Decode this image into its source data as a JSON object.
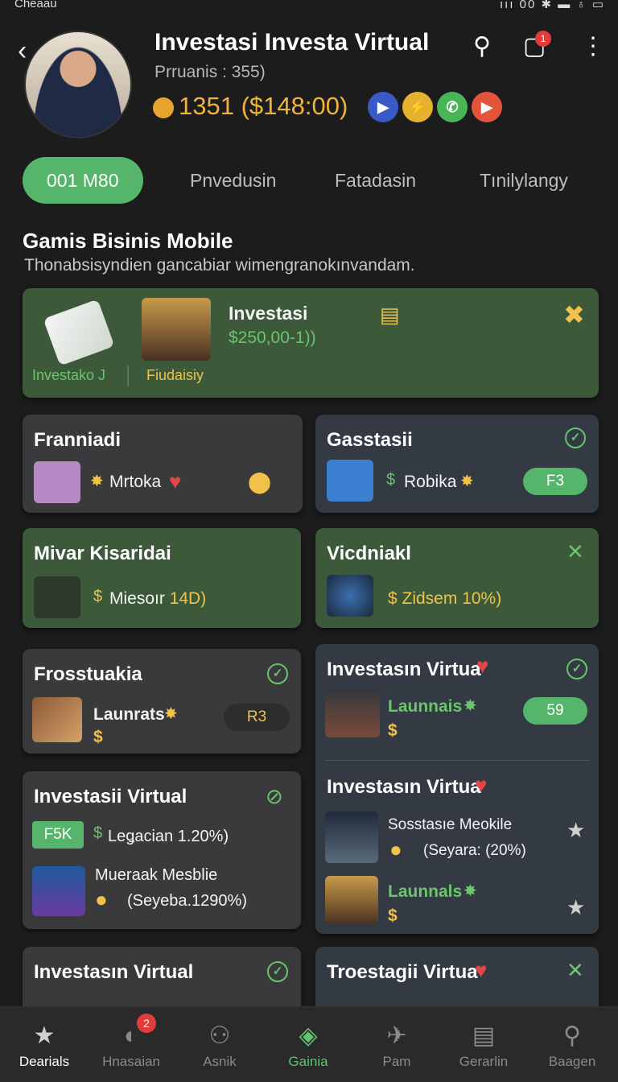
{
  "status_bar": {
    "left": "Cheaau",
    "right": "ııı 00  ✱ ▬ ♁ ▭"
  },
  "header": {
    "title": "Investasi Investa Virtual",
    "subtitle": "Prruanis : 355)",
    "balance": "1351  ($148:00)",
    "apps": [
      "▶",
      "⚡",
      "✆",
      "▶"
    ],
    "cart_badge": "1"
  },
  "tabs": [
    "001 M80",
    "Pnvedusin",
    "Fatadasin",
    "Tınilylangy"
  ],
  "section": {
    "title": "Gamis Bisinis Mobile",
    "subtitle": "Thonabsisyndien gancabiar wimengranokınvandam."
  },
  "featured": {
    "left_label": "Investako J",
    "mid_label": "Fiudaisiy",
    "title": "Investasi",
    "value": "$250,00-1))"
  },
  "cards": {
    "c1": {
      "title": "Franniadi",
      "line": "Mrtoka"
    },
    "c2": {
      "title": "Gasstasii",
      "line": "Robika",
      "pill": "F3"
    },
    "c3": {
      "title": "Mivar Kisaridai",
      "line": "Miesoır",
      "value": "14D)"
    },
    "c4": {
      "title": "Vicdniakl",
      "value": "$ Zidsem 10%)"
    },
    "c5": {
      "title": "Frosstuakia",
      "line": "Launrats",
      "line2": "$",
      "pill": "R3"
    },
    "c6": {
      "title": "Investasın Virtua",
      "line": "Launnais",
      "line2": "$",
      "pill": "59"
    },
    "c7": {
      "title": "Investasii Virtual",
      "pill": "F5K",
      "line": "Leǥacian 1.20%)",
      "sub_title": "Mueraak Mesblie",
      "sub_value": "(Seyeba.1290%)"
    },
    "c8": {
      "title": "Investasın Virtua",
      "line": "Sosstasıe Meokile",
      "value": "(Seyara: (20%)",
      "line2": "Launnals",
      "line3": "$"
    },
    "c9": {
      "title": "Investasın Virtual"
    },
    "c10": {
      "title": "Troestagii Virtua"
    }
  },
  "nav": [
    {
      "label": "Dearials",
      "badge": ""
    },
    {
      "label": "Hnasaian",
      "badge": "2"
    },
    {
      "label": "Asnik",
      "badge": ""
    },
    {
      "label": "Gainia",
      "badge": ""
    },
    {
      "label": "Pam",
      "badge": ""
    },
    {
      "label": "Gerarlin",
      "badge": ""
    },
    {
      "label": "Baagen",
      "badge": ""
    }
  ]
}
